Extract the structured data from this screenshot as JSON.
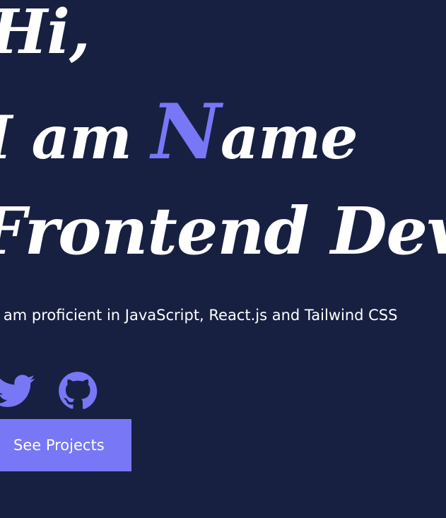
{
  "hero": {
    "greeting": "Hi,",
    "intro_prefix": "I am ",
    "name_initial": "N",
    "name_rest": "ame",
    "role": "Frontend Developer",
    "bio": "I am proficient in JavaScript, React.js and Tailwind CSS"
  },
  "social": [
    {
      "icon": "twitter-icon"
    },
    {
      "icon": "github-icon"
    }
  ],
  "cta": {
    "label": "See Projects"
  },
  "colors": {
    "background": "#172041",
    "accent": "#7877f6",
    "text": "#ffffff"
  }
}
